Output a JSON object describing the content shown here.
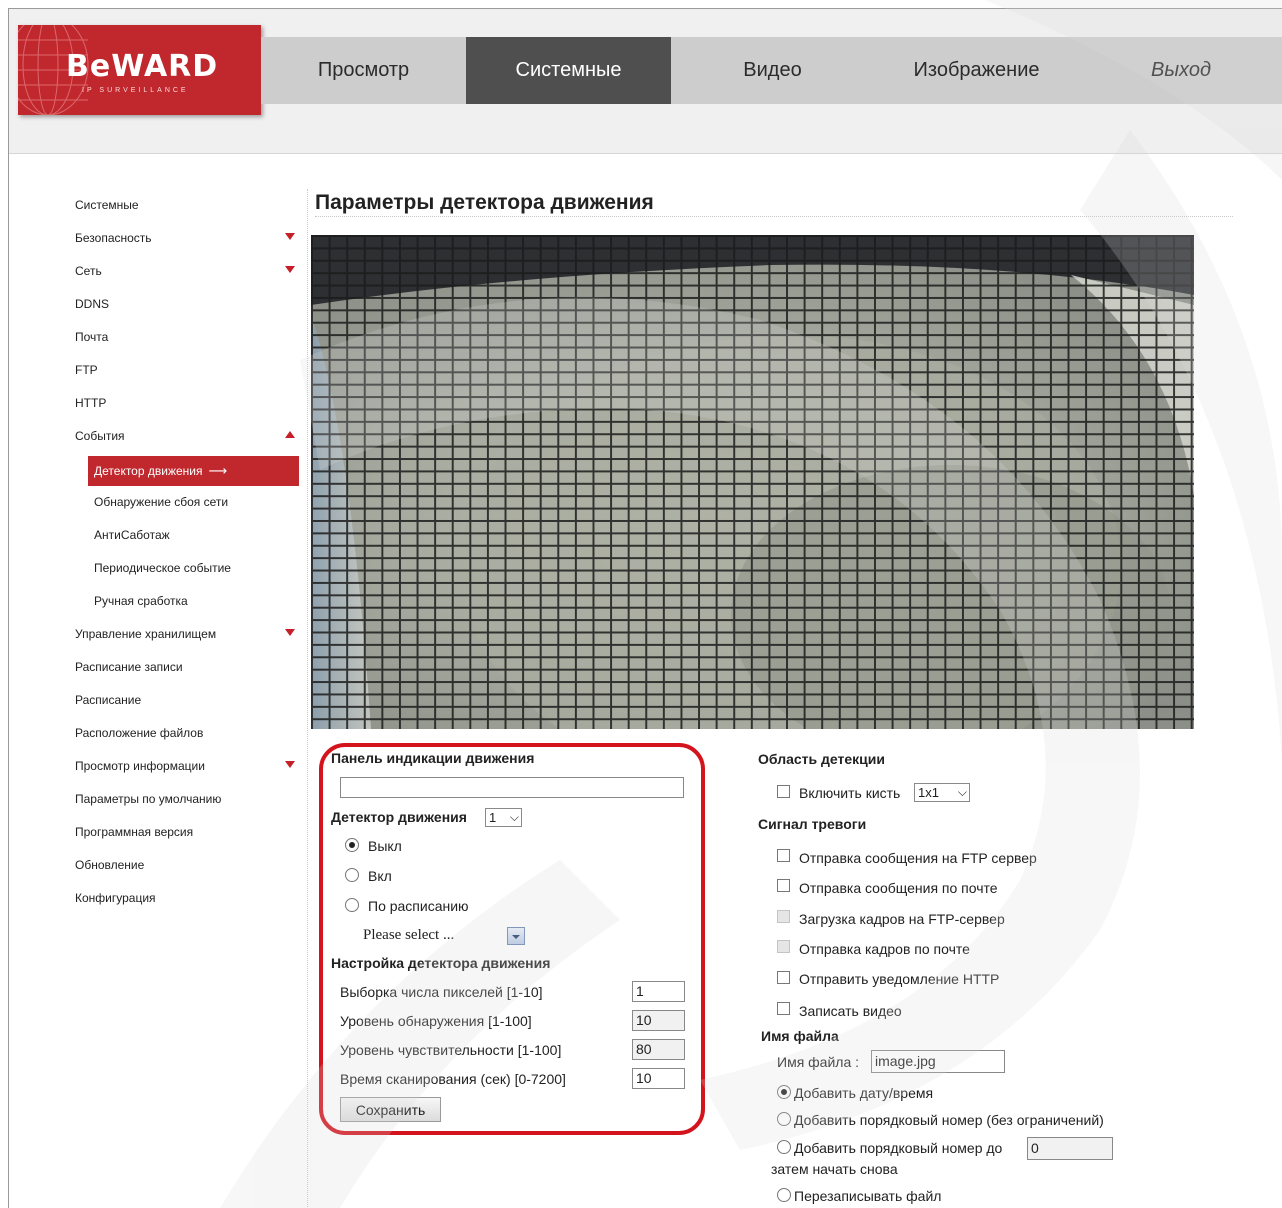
{
  "logo": {
    "brand": "BeWARD",
    "subtitle": "IP SURVEILLANCE"
  },
  "nav": {
    "tabs": [
      {
        "label": "Просмотр"
      },
      {
        "label": "Системные"
      },
      {
        "label": "Видео"
      },
      {
        "label": "Изображение"
      },
      {
        "label": "Выход"
      }
    ],
    "active": "Системные"
  },
  "sidebar": {
    "items": [
      {
        "label": "Системные"
      },
      {
        "label": "Безопасность",
        "arrow": "down"
      },
      {
        "label": "Сеть",
        "arrow": "down"
      },
      {
        "label": "DDNS"
      },
      {
        "label": "Почта"
      },
      {
        "label": "FTP"
      },
      {
        "label": "HTTP"
      },
      {
        "label": "События",
        "arrow": "up"
      },
      {
        "label": "Детектор движения",
        "active": true,
        "sub": true
      },
      {
        "label": "Обнаружение сбоя сети",
        "sub": true
      },
      {
        "label": "АнтиСаботаж",
        "sub": true
      },
      {
        "label": "Периодическое событие",
        "sub": true
      },
      {
        "label": "Ручная сработка",
        "sub": true
      },
      {
        "label": "Управление хранилищем",
        "arrow": "down"
      },
      {
        "label": "Расписание записи"
      },
      {
        "label": "Расписание"
      },
      {
        "label": "Расположение файлов"
      },
      {
        "label": "Просмотр информации",
        "arrow": "down"
      },
      {
        "label": "Параметры по умолчанию"
      },
      {
        "label": "Программная версия"
      },
      {
        "label": "Обновление"
      },
      {
        "label": "Конфигурация"
      }
    ]
  },
  "main": {
    "title": "Параметры детектора движения",
    "indicator_panel_label": "Панель индикации движения",
    "detector_label": "Детектор движения",
    "detector_select": "1",
    "mode_options": [
      {
        "label": "Выкл",
        "checked": true
      },
      {
        "label": "Вкл",
        "checked": false
      },
      {
        "label": "По расписанию",
        "checked": false
      }
    ],
    "schedule_select": "Please select ...",
    "settings_label": "Настройка детектора движения",
    "settings": [
      {
        "label": "Выборка числа пикселей [1-10]",
        "value": "1"
      },
      {
        "label": "Уровень обнаружения [1-100]",
        "value": "10"
      },
      {
        "label": "Уровень чувствительности [1-100]",
        "value": "80"
      },
      {
        "label": "Время сканирования (сек) [0-7200]",
        "value": "10"
      }
    ],
    "save_label": "Сохранить"
  },
  "detection_area": {
    "title": "Область детекции",
    "brush_label": "Включить кисть",
    "brush_size": "1x1"
  },
  "alarm": {
    "title": "Сигнал тревоги",
    "options": [
      {
        "label": "Отправка сообщения на FTP сервер",
        "disabled": false
      },
      {
        "label": "Отправка сообщения по почте",
        "disabled": false
      },
      {
        "label": "Загрузка кадров на FTP-сервер",
        "disabled": true
      },
      {
        "label": "Отправка кадров по почте",
        "disabled": true
      },
      {
        "label": "Отправить уведомление HTTP",
        "disabled": false
      },
      {
        "label": "Записать видео",
        "disabled": false
      }
    ]
  },
  "filename": {
    "title": "Имя файла",
    "field_label": "Имя файла :",
    "value": "image.jpg",
    "options": [
      {
        "label": "Добавить дату/время",
        "checked": true
      },
      {
        "label": "Добавить порядковый номер (без ограничений)",
        "checked": false
      },
      {
        "label": "Добавить порядковый номер до",
        "checked": false
      },
      {
        "label": "Перезаписывать файл",
        "checked": false
      }
    ],
    "seq_limit": "0",
    "restart_label": "затем начать снова"
  },
  "colors": {
    "brand_red": "#c0282e",
    "active_tab": "#4f4f4f",
    "highlight_ring": "#d3141c"
  }
}
